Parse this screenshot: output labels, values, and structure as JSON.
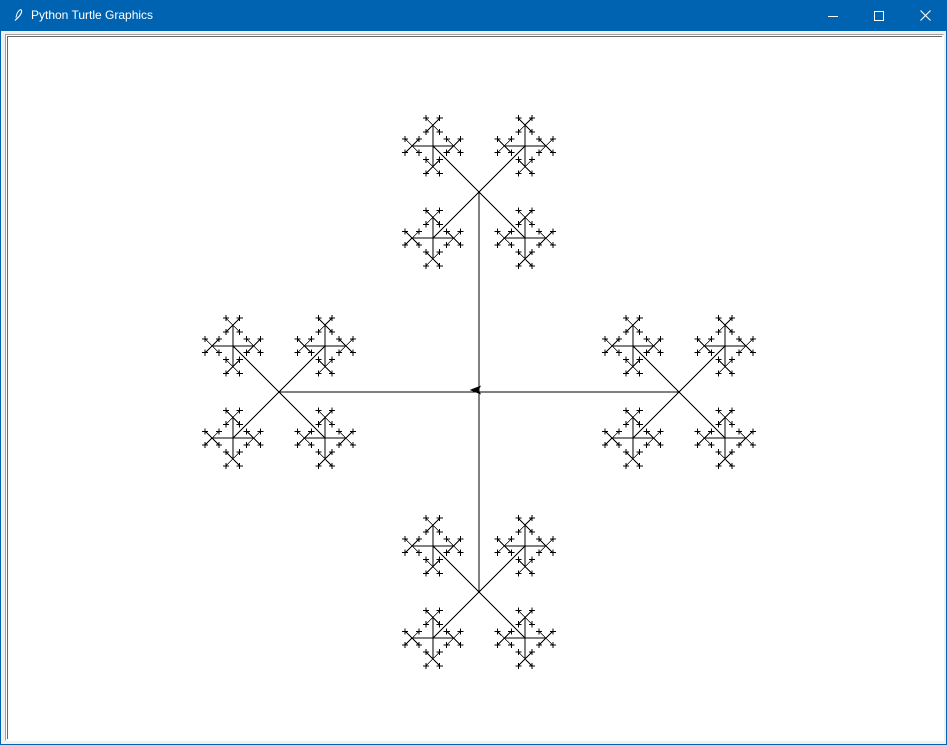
{
  "window": {
    "title": "Python Turtle Graphics",
    "titlebar_color": "#0063b1",
    "icons": {
      "app": "feather-icon",
      "minimize": "minimize-icon",
      "maximize": "maximize-icon",
      "close": "close-icon"
    }
  },
  "canvas": {
    "background": "#ffffff",
    "pen_color": "#000000",
    "figure": "recursive-cross-fractal",
    "recursion_depth": 5,
    "turtle_shape": "classic",
    "turtle_heading": "west"
  }
}
